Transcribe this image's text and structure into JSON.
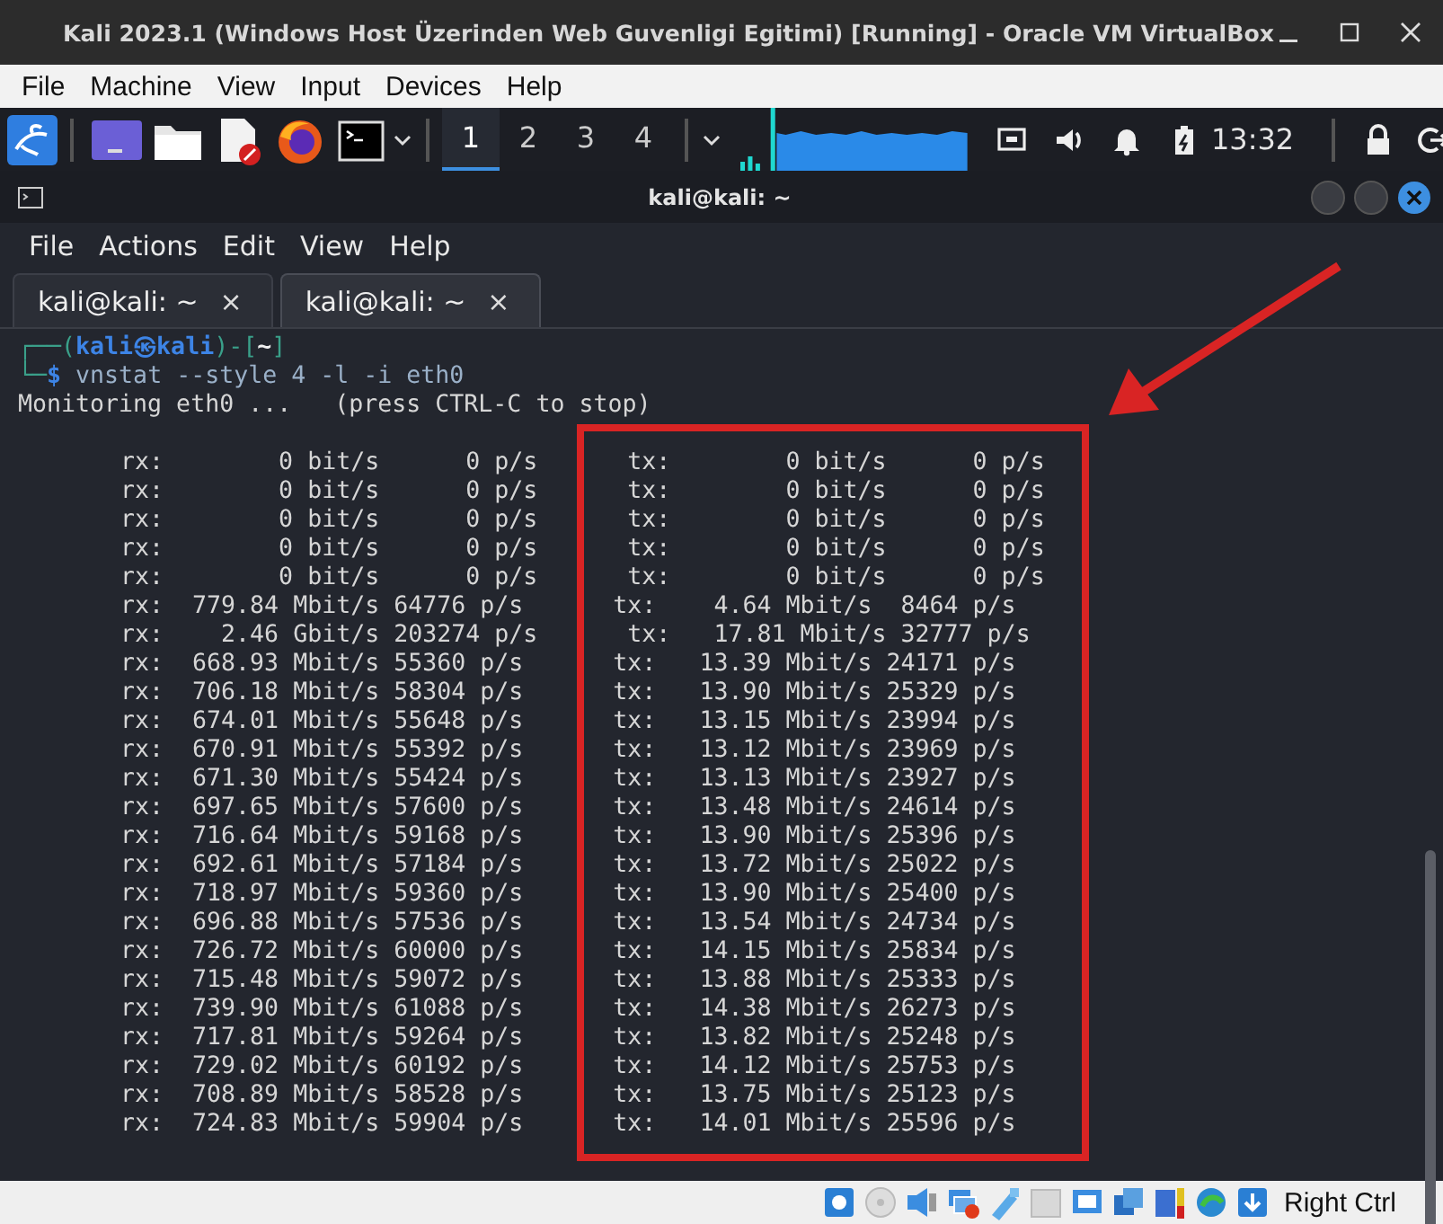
{
  "window": {
    "title": "Kali 2023.1 (Windows Host Üzerinden Web Guvenligi Egitimi) [Running] - Oracle VM VirtualBox"
  },
  "menu": [
    "File",
    "Machine",
    "View",
    "Input",
    "Devices",
    "Help"
  ],
  "panel": {
    "workspaces": [
      {
        "label": "1",
        "selected": true
      },
      {
        "label": "2",
        "selected": false
      },
      {
        "label": "3",
        "selected": false
      },
      {
        "label": "4",
        "selected": false
      }
    ],
    "clock": "13:32"
  },
  "terminal": {
    "title": "kali@kali: ~",
    "menu": [
      "File",
      "Actions",
      "Edit",
      "View",
      "Help"
    ],
    "tabs": [
      {
        "label": "kali@kali: ~",
        "close": "×",
        "selected": false
      },
      {
        "label": "kali@kali: ~",
        "close": "×",
        "selected": true
      }
    ],
    "prompt": [
      [
        {
          "kind": "frame",
          "text": "┌──("
        },
        {
          "kind": "user",
          "text": "kali㉿kali"
        },
        {
          "kind": "frame",
          "text": ")-["
        },
        {
          "kind": "cwd",
          "text": "~"
        },
        {
          "kind": "frame",
          "text": "]"
        }
      ],
      [
        {
          "kind": "frame",
          "text": "└─"
        },
        {
          "kind": "user",
          "text": "$"
        },
        {
          "kind": "command",
          "text": " vnstat --style 4 -l -i eth0"
        }
      ]
    ],
    "status": "Monitoring eth0 ...   (press CTRL-C to stop)",
    "rows": [
      {
        "rx": "rx:        0 bit/s      0 p/s",
        "tx": "tx:        0 bit/s      0 p/s"
      },
      {
        "rx": "rx:        0 bit/s      0 p/s",
        "tx": "tx:        0 bit/s      0 p/s"
      },
      {
        "rx": "rx:        0 bit/s      0 p/s",
        "tx": "tx:        0 bit/s      0 p/s"
      },
      {
        "rx": "rx:        0 bit/s      0 p/s",
        "tx": "tx:        0 bit/s      0 p/s"
      },
      {
        "rx": "rx:        0 bit/s      0 p/s",
        "tx": "tx:        0 bit/s      0 p/s"
      },
      {
        "rx": "rx:  779.84 Mbit/s 64776 p/s",
        "tx": "tx:    4.64 Mbit/s  8464 p/s"
      },
      {
        "rx": "rx:    2.46 Gbit/s 203274 p/s",
        "tx": "tx:   17.81 Mbit/s 32777 p/s"
      },
      {
        "rx": "rx:  668.93 Mbit/s 55360 p/s",
        "tx": "tx:   13.39 Mbit/s 24171 p/s"
      },
      {
        "rx": "rx:  706.18 Mbit/s 58304 p/s",
        "tx": "tx:   13.90 Mbit/s 25329 p/s"
      },
      {
        "rx": "rx:  674.01 Mbit/s 55648 p/s",
        "tx": "tx:   13.15 Mbit/s 23994 p/s"
      },
      {
        "rx": "rx:  670.91 Mbit/s 55392 p/s",
        "tx": "tx:   13.12 Mbit/s 23969 p/s"
      },
      {
        "rx": "rx:  671.30 Mbit/s 55424 p/s",
        "tx": "tx:   13.13 Mbit/s 23927 p/s"
      },
      {
        "rx": "rx:  697.65 Mbit/s 57600 p/s",
        "tx": "tx:   13.48 Mbit/s 24614 p/s"
      },
      {
        "rx": "rx:  716.64 Mbit/s 59168 p/s",
        "tx": "tx:   13.90 Mbit/s 25396 p/s"
      },
      {
        "rx": "rx:  692.61 Mbit/s 57184 p/s",
        "tx": "tx:   13.72 Mbit/s 25022 p/s"
      },
      {
        "rx": "rx:  718.97 Mbit/s 59360 p/s",
        "tx": "tx:   13.90 Mbit/s 25400 p/s"
      },
      {
        "rx": "rx:  696.88 Mbit/s 57536 p/s",
        "tx": "tx:   13.54 Mbit/s 24734 p/s"
      },
      {
        "rx": "rx:  726.72 Mbit/s 60000 p/s",
        "tx": "tx:   14.15 Mbit/s 25834 p/s"
      },
      {
        "rx": "rx:  715.48 Mbit/s 59072 p/s",
        "tx": "tx:   13.88 Mbit/s 25333 p/s"
      },
      {
        "rx": "rx:  739.90 Mbit/s 61088 p/s",
        "tx": "tx:   14.38 Mbit/s 26273 p/s"
      },
      {
        "rx": "rx:  717.81 Mbit/s 59264 p/s",
        "tx": "tx:   13.82 Mbit/s 25248 p/s"
      },
      {
        "rx": "rx:  729.02 Mbit/s 60192 p/s",
        "tx": "tx:   14.12 Mbit/s 25753 p/s"
      },
      {
        "rx": "rx:  708.89 Mbit/s 58528 p/s",
        "tx": "tx:   13.75 Mbit/s 25123 p/s"
      },
      {
        "rx": "rx:  724.83 Mbit/s 59904 p/s",
        "tx": "tx:   14.01 Mbit/s 25596 p/s"
      }
    ]
  },
  "status_bar": {
    "host_key": "Right Ctrl"
  }
}
